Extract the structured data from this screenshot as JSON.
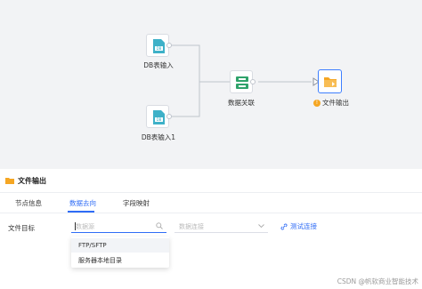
{
  "canvas": {
    "nodes": [
      {
        "id": "db-input-1",
        "label": "DB表输入",
        "icon_text": "DB"
      },
      {
        "id": "db-input-2",
        "label": "DB表输入1",
        "icon_text": "DB"
      },
      {
        "id": "data-join",
        "label": "数据关联"
      },
      {
        "id": "file-output",
        "label": "文件输出",
        "warning": "!"
      }
    ]
  },
  "panel": {
    "title": "文件输出",
    "tabs": [
      {
        "label": "节点信息",
        "active": false
      },
      {
        "label": "数据去向",
        "active": true
      },
      {
        "label": "字段映射",
        "active": false
      }
    ],
    "target_label": "文件目标",
    "datasource_placeholder": "数据源",
    "dataconn_placeholder": "数据连接",
    "test_link": "测试连接",
    "dropdown_options": [
      "FTP/SFTP",
      "服务器本地目录"
    ]
  },
  "watermark": "CSDN @帆软商业智能技术",
  "colors": {
    "accent": "#2f6cf6",
    "db_icon": "#3eb1c8",
    "join_icon": "#2fa36b",
    "folder_icon": "#f5a623",
    "warning": "#f5a623"
  }
}
